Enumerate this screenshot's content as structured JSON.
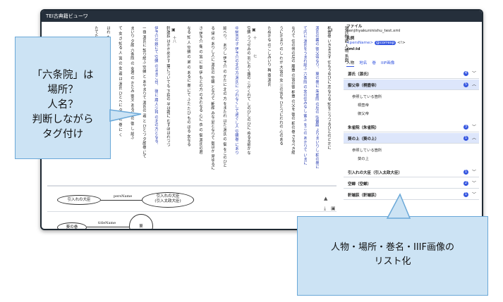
{
  "window": {
    "title": "TEI古典籍ビューワ"
  },
  "text_columns": [
    {
      "text": "桐壺巻 いきまきず 切もうゆぴに 恋ならる 知をこうつるひとのどかに"
    },
    {
      "text": "源氏の義の 御父帝なり。 葵の巻に 朱雀院 の后の 弘徽殿 よりまいりし 桐の巻に"
    },
    {
      "text": "て内に 源氏をうまれ給ふ 六条院 の女の住みなし 紫上 をこの あかりて いまに"
    },
    {
      "text": "なりて 住の帝の后の 藤壺 の宮の御 桐壺 の父を 御の 桐の巻 さるべき給"
    },
    {
      "text": "うにかまり のし わが 大宮の 女 三の宮も ひとつにわれの 心のある"
    },
    {
      "text": "たぬかな のこしみいり 梅 壺 源氏"
    },
    {
      "text": "空蝉 うつせみの 羽におく露の こがくれて しのびしのびに ぬるる袖かな"
    },
    {
      "text": "中納言の子 伊予介の北の方 源氏に つれなくして過ぐし人 空蝉巻 にあり"
    },
    {
      "text": "給へり。 ありし 伊予介 の かたに 北の 方 をまたれ はた 源氏 の 御 をこのひと"
    },
    {
      "text": "る 帰 の ありし人に 源氏の 空蝉 となりて 朝顔 みな 尼となりて 御ほか 見ゆるに"
    },
    {
      "text": "さ 伊予介 衛 の 宮 に 御 伊 もとの方 のきわなる 心に 衣 の 御 源氏の君"
    },
    {
      "text": "なる 知 人 空蝉 の 弟 の あるに 巻 にて ふた たび もの ぼる 女なる"
    },
    {
      "text": "軒端荻 はかかめかす 葉についても 下荻の 半は霜に むすぼほれつつ"
    },
    {
      "text": "伊予介の娘にて 空蝉 のままこ也。 後に 蔵人少将 の北の方となる。"
    },
    {
      "text": "一夜 源氏に 契り給ふ 空蝉 と あやまりて 源氏の 君 と ひとつ 夕顔巻 にて"
    },
    {
      "text": "まいり 夕顔 六条院 の 女君 の かたみ 御文 あるに の 御 し 給ふ"
    },
    {
      "text": "て 女 さ 知る 人 宮 の 女 君 は 源氏 ひとへに 夕 顔の 巻 に く"
    },
    {
      "text": "はれ たる 人 の 心 に は い ふ。 源 の 巻 に の"
    },
    {
      "text": "たてたへり。"
    }
  ],
  "page_marks": [
    {
      "label": "一",
      "num": "八"
    },
    {
      "label": "七",
      "num": "十"
    },
    {
      "label": "",
      "num": "十八"
    }
  ],
  "meta_column": "源氏物語 人物 系図",
  "graph": {
    "row1": {
      "left_node": "引入れの大臣",
      "edge_label": "persName",
      "right_node_line1": "引入れの大臣",
      "right_node_line2": "(引入太政大臣)"
    },
    "row2": {
      "left_node": "葵の巻",
      "edge_label": "titleName",
      "right_node": "葵"
    }
  },
  "sidebar": {
    "file_label": "ファイル",
    "file_name": "genjihyakuninishu_test.xml",
    "note_label": "凡例",
    "persname_tag": "<persName>",
    "corresp_tag": "@corresp",
    "corresp_suffix": "<!>",
    "xmlid_label": "xml:id",
    "tabs": [
      "人物",
      "地名",
      "巻",
      "IIIF画像"
    ],
    "items": [
      {
        "label": "源氏（源氏）",
        "count": "4",
        "selected": false,
        "expanded": false
      },
      {
        "label": "御父帝（桐壺帝）",
        "count": "5",
        "selected": true,
        "expanded": true,
        "sub_header": "参照している箇所",
        "subs": [
          "桐壺帝",
          "御父帝"
        ]
      },
      {
        "label": "朱雀院（朱雀院）",
        "count": "3",
        "selected": false,
        "expanded": false
      },
      {
        "label": "葵の上（葵の上）",
        "count": "1",
        "selected": true,
        "expanded": true,
        "sub_header": "参照している箇所",
        "subs": [
          "葵の上"
        ]
      },
      {
        "label": "引入れの大臣（引入太政大臣）",
        "count": "1",
        "selected": false,
        "expanded": false
      },
      {
        "label": "空蝉（空蝉）",
        "count": "2",
        "selected": false,
        "expanded": false
      },
      {
        "label": "軒端荻（軒端荻）",
        "count": "1",
        "selected": false,
        "expanded": false
      }
    ]
  },
  "callouts": {
    "left_lines": [
      "「六条院」は",
      "場所？",
      "人名？",
      "判断しながら",
      "タグ付け"
    ],
    "right_lines": [
      "人物・場所・巻名・IIIF画像の",
      "リスト化"
    ]
  },
  "colors": {
    "accent": "#3556e0",
    "titlebar": "#252f3b",
    "callout_fill": "#cce3f4",
    "callout_border": "#6aa8d8",
    "selected_row": "#dde6fb"
  }
}
